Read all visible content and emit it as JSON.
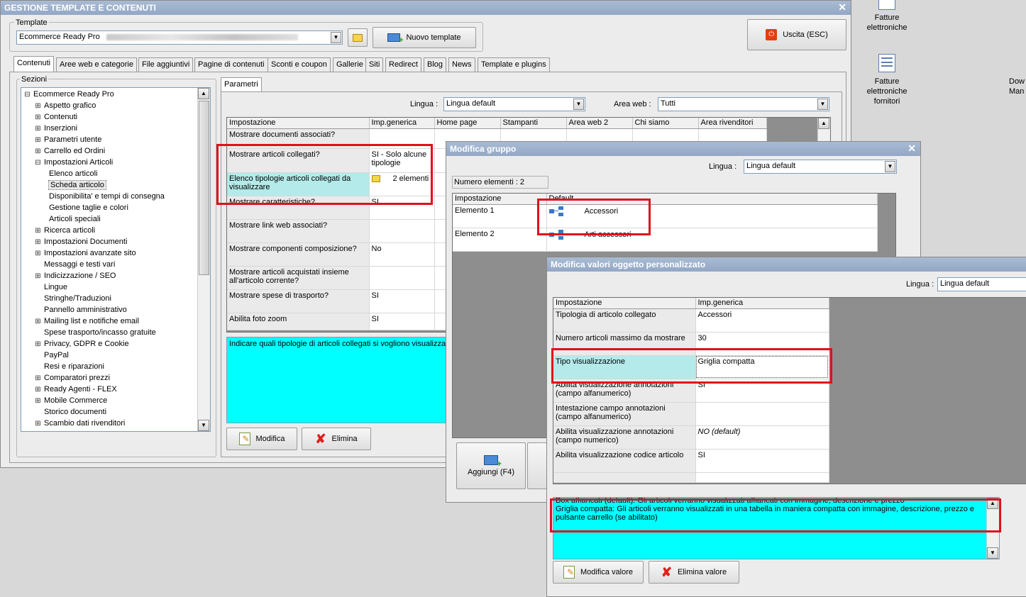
{
  "desktop": {
    "icons": [
      {
        "label": "Fatture\nelettroniche"
      },
      {
        "label": "Fatture\nelettroniche\nfornitori"
      },
      {
        "label": "Dow\nMan"
      }
    ]
  },
  "main_window": {
    "title": "GESTIONE TEMPLATE E CONTENUTI",
    "template_group_label": "Template",
    "template_value": "Ecommerce Ready Pro",
    "new_template_button": "Nuovo template",
    "exit_button": "Uscita (ESC)",
    "tabs": [
      "Contenuti",
      "Aree web e categorie",
      "File aggiuntivi",
      "Pagine di contenuti",
      "Sconti e coupon",
      "Gallerie",
      "Siti",
      "Redirect",
      "Blog",
      "News",
      "Template e plugins"
    ],
    "sections_label": "Sezioni",
    "tree": [
      {
        "label": "Ecommerce Ready Pro",
        "level": 0,
        "exp": "-"
      },
      {
        "label": "Aspetto grafico",
        "level": 1,
        "exp": "+"
      },
      {
        "label": "Contenuti",
        "level": 1,
        "exp": "+"
      },
      {
        "label": "Inserzioni",
        "level": 1,
        "exp": "+"
      },
      {
        "label": "Parametri utente",
        "level": 1,
        "exp": "+"
      },
      {
        "label": "Carrello ed Ordini",
        "level": 1,
        "exp": "+"
      },
      {
        "label": "Impostazioni Articoli",
        "level": 1,
        "exp": "-"
      },
      {
        "label": "Elenco articoli",
        "level": 2,
        "exp": ""
      },
      {
        "label": "Scheda articolo",
        "level": 2,
        "exp": "",
        "selected": true
      },
      {
        "label": "Disponibilita' e tempi di consegna",
        "level": 2,
        "exp": ""
      },
      {
        "label": "Gestione taglie e colori",
        "level": 2,
        "exp": ""
      },
      {
        "label": "Articoli speciali",
        "level": 2,
        "exp": ""
      },
      {
        "label": "Ricerca articoli",
        "level": 1,
        "exp": "+"
      },
      {
        "label": "Impostazioni Documenti",
        "level": 1,
        "exp": "+"
      },
      {
        "label": "Impostazioni avanzate sito",
        "level": 1,
        "exp": "+"
      },
      {
        "label": "Messaggi e testi vari",
        "level": 1,
        "exp": ""
      },
      {
        "label": "Indicizzazione / SEO",
        "level": 1,
        "exp": "+"
      },
      {
        "label": "Lingue",
        "level": 1,
        "exp": ""
      },
      {
        "label": "Stringhe/Traduzioni",
        "level": 1,
        "exp": ""
      },
      {
        "label": "Pannello amministrativo",
        "level": 1,
        "exp": ""
      },
      {
        "label": "Mailing list e notifiche email",
        "level": 1,
        "exp": "+"
      },
      {
        "label": "Spese trasporto/incasso gratuite",
        "level": 1,
        "exp": ""
      },
      {
        "label": "Privacy, GDPR e Cookie",
        "level": 1,
        "exp": "+"
      },
      {
        "label": "PayPal",
        "level": 1,
        "exp": ""
      },
      {
        "label": "Resi e riparazioni",
        "level": 1,
        "exp": ""
      },
      {
        "label": "Comparatori prezzi",
        "level": 1,
        "exp": "+"
      },
      {
        "label": "Ready Agenti - FLEX",
        "level": 1,
        "exp": "+"
      },
      {
        "label": "Mobile Commerce",
        "level": 1,
        "exp": "+"
      },
      {
        "label": "Storico documenti",
        "level": 1,
        "exp": ""
      },
      {
        "label": "Scambio dati rivenditori",
        "level": 1,
        "exp": "+"
      }
    ],
    "params_tab": "Parametri",
    "lingua_label": "Lingua :",
    "lingua_value": "Lingua default",
    "area_web_label": "Area web :",
    "area_web_value": "Tutti",
    "grid_headers": [
      "Impostazione",
      "Imp.generica",
      "Home page",
      "Stampanti",
      "Area web 2",
      "Chi siamo",
      "Area rivenditori"
    ],
    "grid_rows": [
      {
        "setting": "Mostrare documenti associati?",
        "value": ""
      },
      {
        "setting": "Mostrare articoli collegati?",
        "value": "SI - Solo alcune tipologie"
      },
      {
        "setting": "Elenco tipologie articoli collegati da visualizzare",
        "value": "2 elementi"
      },
      {
        "setting": "Mostrare caratteristiche?",
        "value": "SI"
      },
      {
        "setting": "Mostrare link web associati?",
        "value": ""
      },
      {
        "setting": "Mostrare componenti composizione?",
        "value": "No"
      },
      {
        "setting": "Mostrare articoli acquistati insieme all'articolo corrente?",
        "value": ""
      },
      {
        "setting": "Mostrare spese di trasporto?",
        "value": "SI"
      },
      {
        "setting": "Abilita foto zoom",
        "value": "SI"
      }
    ],
    "description": "Indicare quali tipologie di articoli collegati si vogliono visualizzare",
    "modify_button": "Modifica",
    "delete_button": "Elimina"
  },
  "group_window": {
    "title": "Modifica gruppo",
    "lingua_label": "Lingua :",
    "lingua_value": "Lingua default",
    "count_label": "Numero elementi : 2",
    "headers": [
      "Impostazione",
      "Default"
    ],
    "rows": [
      {
        "setting": "Elemento 1",
        "value": "Accessori"
      },
      {
        "setting": "Elemento 2",
        "value": "Arti accessori"
      }
    ],
    "add_button": "Aggiungi (F4)"
  },
  "values_window": {
    "title": "Modifica valori oggetto personalizzato",
    "lingua_label": "Lingua :",
    "lingua_value": "Lingua default",
    "headers": [
      "Impostazione",
      "Imp.generica"
    ],
    "rows": [
      {
        "setting": "Tipologia di articolo collegato",
        "value": "Accessori"
      },
      {
        "setting": "Numero articoli massimo da mostrare",
        "value": "30"
      },
      {
        "setting": "Tipo visualizzazione",
        "value": "Griglia compatta"
      },
      {
        "setting": "Abilita visualizzazione annotazioni (campo alfanumerico)",
        "value": "SI"
      },
      {
        "setting": "Intestazione campo annotazioni (campo alfanumerico)",
        "value": ""
      },
      {
        "setting": "Abilita visualizzazione annotazioni (campo numerico)",
        "value": "NO (default)"
      },
      {
        "setting": "Abilita visualizzazione codice articolo",
        "value": "SI"
      }
    ],
    "desc_line1": "Box affiancati (default): Gli articoli verranno visualizzati affiancati con immagine, descrizione e prezzo",
    "desc_line2": "Griglia compatta: Gli articoli verranno visualizzati in una tabella in maniera compatta con immagine, descrizione, prezzo e pulsante carrello (se abilitato)",
    "modify_value_button": "Modifica valore",
    "delete_value_button": "Elimina valore"
  },
  "colors": {
    "accent_cyan": "#00ffff",
    "highlight_red": "#e0101c",
    "title_bar": "#9fb3cf"
  }
}
